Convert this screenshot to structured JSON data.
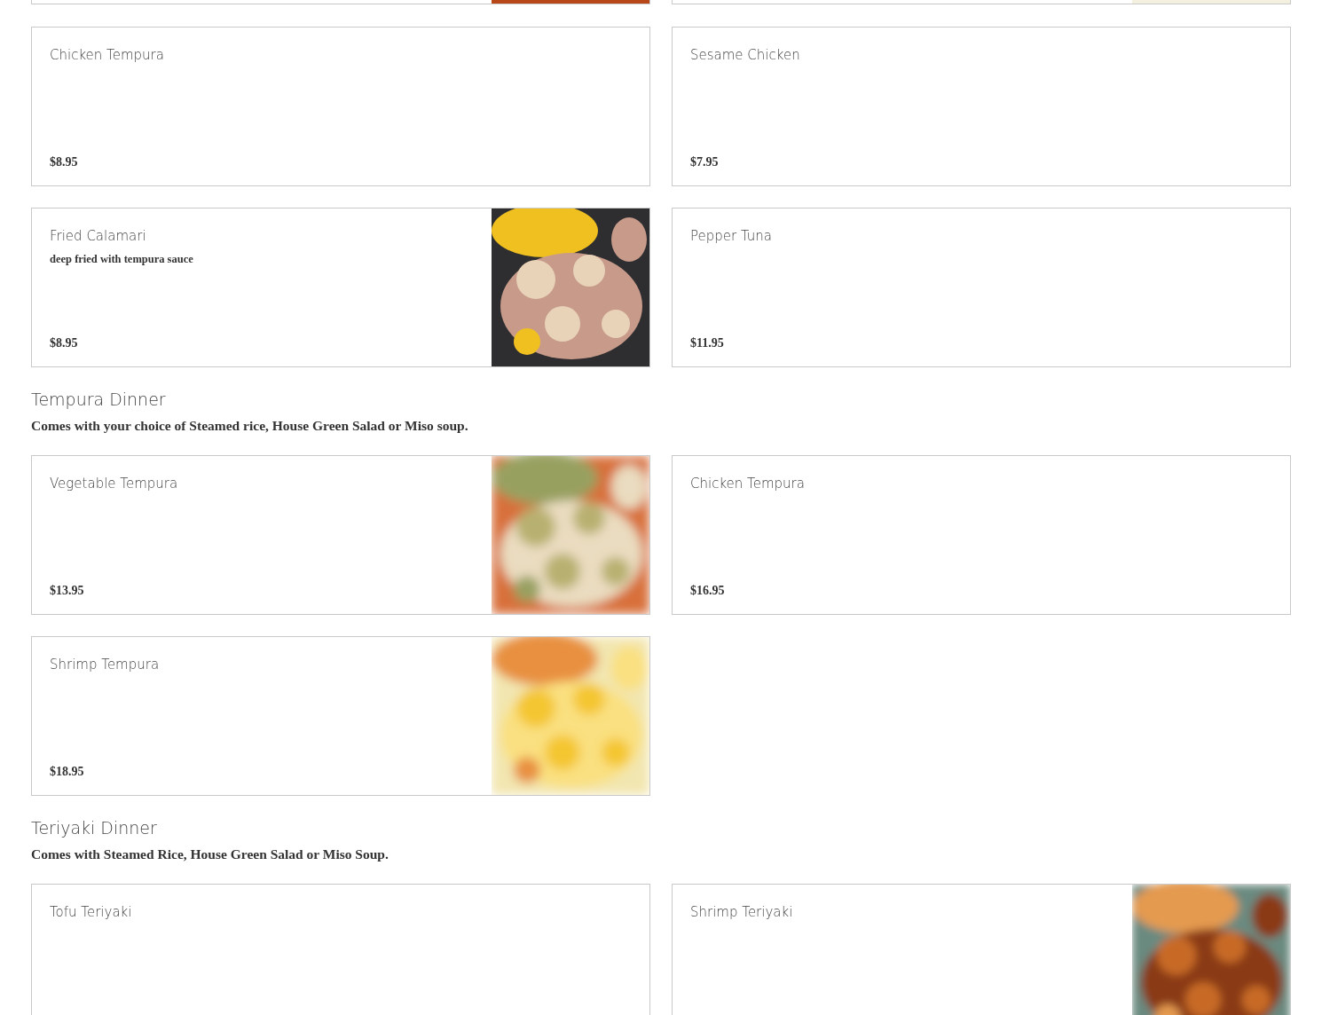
{
  "sections": [
    {
      "items": [
        {
          "kind": "plain",
          "name": "Chicken Tempura",
          "price": "$8.95"
        },
        {
          "kind": "plain",
          "name": "Sesame Chicken",
          "price": "$7.95"
        },
        {
          "kind": "picture",
          "name": "Fried Calamari",
          "description": "deep fried with tempura sauce",
          "price": "$8.95"
        },
        {
          "kind": "plain",
          "name": "Pepper Tuna",
          "price": "$11.95"
        }
      ]
    },
    {
      "title": "Tempura Dinner",
      "note": "Comes with your choice of Steamed rice, House Green Salad or Miso soup.",
      "items": [
        {
          "kind": "picture",
          "name": "Vegetable Tempura",
          "price": "$13.95"
        },
        {
          "kind": "plain",
          "name": "Chicken Tempura",
          "price": "$16.95"
        },
        {
          "kind": "picture",
          "name": "Shrimp Tempura",
          "price": "$18.95"
        }
      ]
    },
    {
      "title": "Teriyaki Dinner",
      "note": "Comes with Steamed Rice, House Green Salad or Miso Soup.",
      "items": [
        {
          "kind": "plain",
          "name": "Tofu Teriyaki"
        },
        {
          "kind": "picture",
          "name": "Shrimp Teriyaki"
        }
      ]
    }
  ]
}
